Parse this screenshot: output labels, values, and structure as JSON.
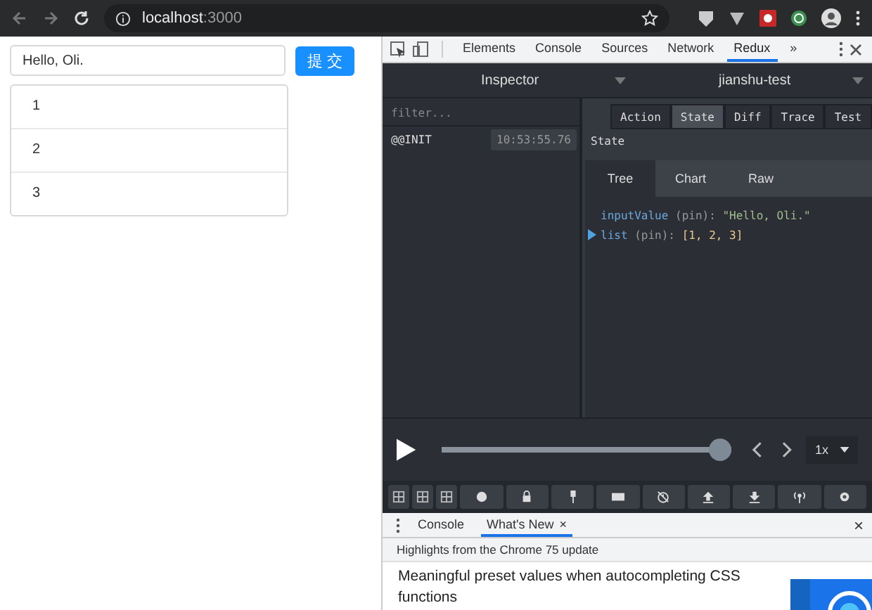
{
  "browser": {
    "address_host": "localhost",
    "address_port": ":3000"
  },
  "page": {
    "input": {
      "value": "Hello, Oli."
    },
    "submit_button": "提 交",
    "list": [
      "1",
      "2",
      "3"
    ]
  },
  "devtools": {
    "tabs": [
      {
        "label": "Elements",
        "selected": false
      },
      {
        "label": "Console",
        "selected": false
      },
      {
        "label": "Sources",
        "selected": false
      },
      {
        "label": "Network",
        "selected": false
      },
      {
        "label": "Redux",
        "selected": true
      }
    ],
    "more": "»",
    "redux": {
      "monitor": "Inspector",
      "instance": "jianshu-test",
      "filter_placeholder": "filter...",
      "actions": [
        {
          "name": "@@INIT",
          "time": "10:53:55.76"
        }
      ],
      "view_tabs": [
        {
          "label": "Action",
          "selected": false
        },
        {
          "label": "State",
          "selected": true
        },
        {
          "label": "Diff",
          "selected": false
        },
        {
          "label": "Trace",
          "selected": false
        },
        {
          "label": "Test",
          "selected": false
        }
      ],
      "section_title": "State",
      "format_tabs": [
        {
          "label": "Tree",
          "selected": true
        },
        {
          "label": "Chart",
          "selected": false
        },
        {
          "label": "Raw",
          "selected": false
        }
      ],
      "tree": [
        {
          "key": "inputValue",
          "tag": "(pin):",
          "value": "\"Hello, Oli.\"",
          "kind": "string",
          "expandable": false
        },
        {
          "key": "list",
          "tag": "(pin):",
          "value": "[1, 2, 3]",
          "kind": "array",
          "expandable": true
        }
      ],
      "slider": {
        "level": 1.0
      },
      "speed": "1x"
    },
    "drawer": {
      "tabs": [
        {
          "label": "Console",
          "selected": false,
          "closable": false
        },
        {
          "label": "What's New",
          "selected": true,
          "closable": true
        }
      ],
      "close": "×",
      "closable_mark": "×",
      "highlight": "Highlights from the Chrome 75 update",
      "article": "Meaningful preset values when autocompleting CSS functions"
    }
  }
}
